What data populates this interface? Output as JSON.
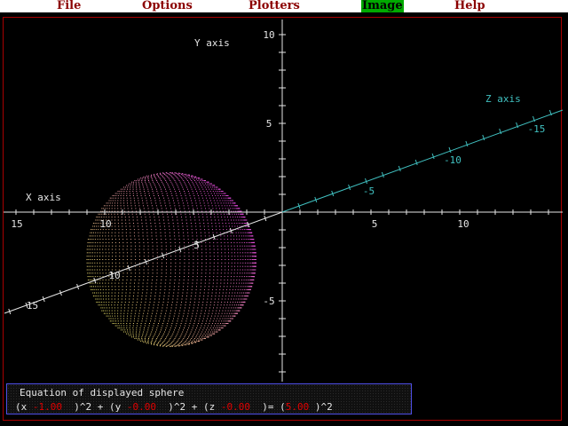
{
  "menu": {
    "items": [
      {
        "label": "File"
      },
      {
        "label": "Options"
      },
      {
        "label": "Plotters"
      },
      {
        "label": "Image",
        "active": true
      },
      {
        "label": "Help"
      }
    ]
  },
  "plot": {
    "x_axis_label": "X axis",
    "y_axis_label": "Y axis",
    "z_axis_label": "Z axis",
    "y_ticks": [
      {
        "value": 10,
        "label": "10"
      },
      {
        "value": 5,
        "label": "5"
      },
      {
        "value": -5,
        "label": "-5"
      }
    ],
    "x_ticks": [
      {
        "value": 5,
        "label": "5"
      },
      {
        "value": 10,
        "label": "10"
      }
    ],
    "z_ticks": [
      {
        "value": -5,
        "label": "-5"
      },
      {
        "value": -10,
        "label": "-10"
      },
      {
        "value": -15,
        "label": "-15"
      }
    ],
    "x_neg_ticks": [
      {
        "value": 10,
        "label": "10"
      },
      {
        "value": 15,
        "label": "15"
      }
    ],
    "diag_ticks": [
      {
        "value": 5,
        "label": "5"
      },
      {
        "value": 10,
        "label": "10"
      },
      {
        "value": 15,
        "label": "15"
      }
    ],
    "sphere": {
      "x": -1.0,
      "y": -0.0,
      "z": -0.0,
      "radius": 5.0
    },
    "colors": {
      "axis": "#e6e6e6",
      "z_axis": "#40c0c0",
      "sphere_top": "#e040e0",
      "sphere_bottom": "#e8e860",
      "frame": "#a80000"
    }
  },
  "equation": {
    "title": "Equation of displayed sphere",
    "p1": "(x ",
    "x_value": "-1.00",
    "p2": "  )^2 + (y ",
    "y_value": "-0.00",
    "p3": "  )^2 + (z ",
    "z_value": "-0.00",
    "p4": "  )= (",
    "r_value": "5.00",
    "p5": " )^2"
  }
}
